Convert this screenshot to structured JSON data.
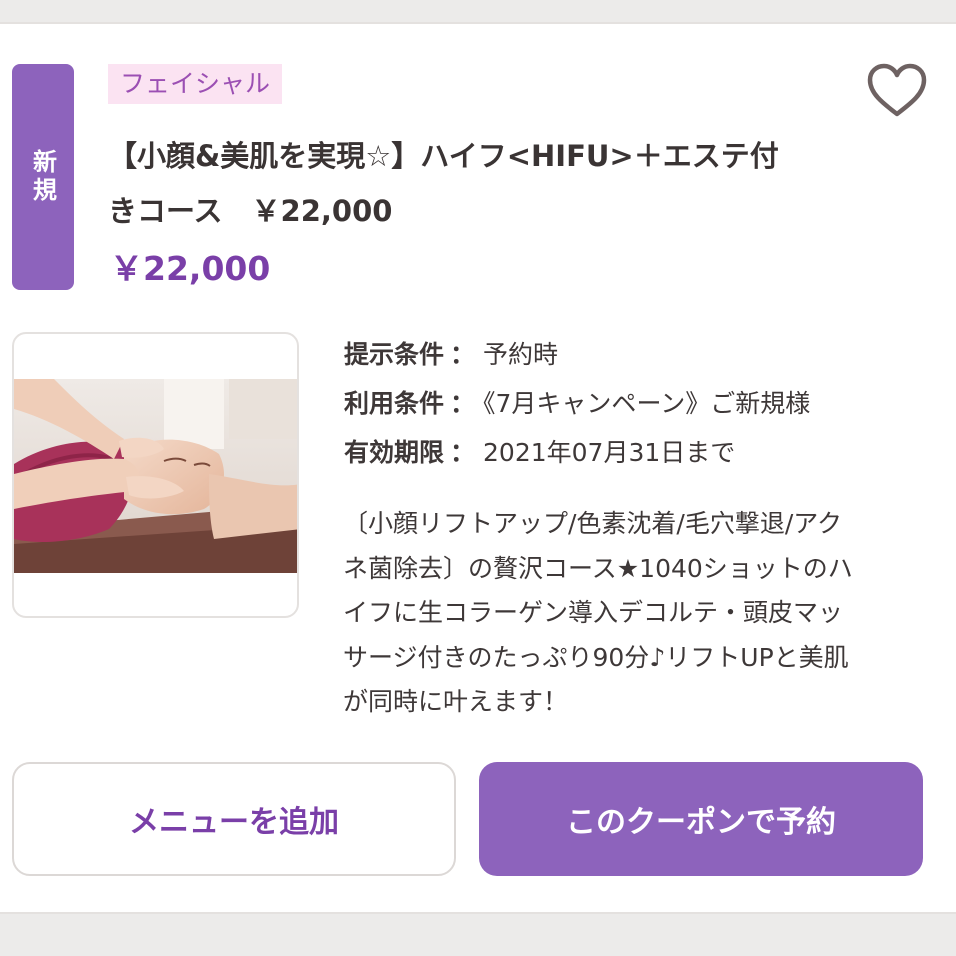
{
  "badge": {
    "new_label": "新規"
  },
  "category": "フェイシャル",
  "coupon": {
    "title_line1": "【小顔&美肌を実現☆】ハイフ<HIFU>＋エステ付",
    "title_line2": "きコース　￥22,000",
    "price": "￥22,000"
  },
  "conditions": [
    {
      "label": "提示条件",
      "value": "予約時"
    },
    {
      "label": "利用条件",
      "value": "《7月キャンペーン》ご新規様"
    },
    {
      "label": "有効期限",
      "value": "2021年07月31日まで"
    }
  ],
  "separator": "：",
  "description": [
    "〔小顔リフトアップ/色素沈着/毛穴撃退/アク",
    "ネ菌除去〕の贅沢コース★1040ショットのハ",
    "イフに生コラーゲン導入デコルテ・頭皮マッ",
    "サージ付きのたっぷり90分♪リフトUPと美肌",
    "が同時に叶えます！"
  ],
  "buttons": {
    "add_menu": "メニューを追加",
    "reserve": "このクーポンで予約"
  },
  "colors": {
    "accent": "#8d63bc",
    "price": "#7a3fa8",
    "tag_bg": "#fbe3f2"
  },
  "icons": {
    "favorite": "heart-outline-icon"
  }
}
